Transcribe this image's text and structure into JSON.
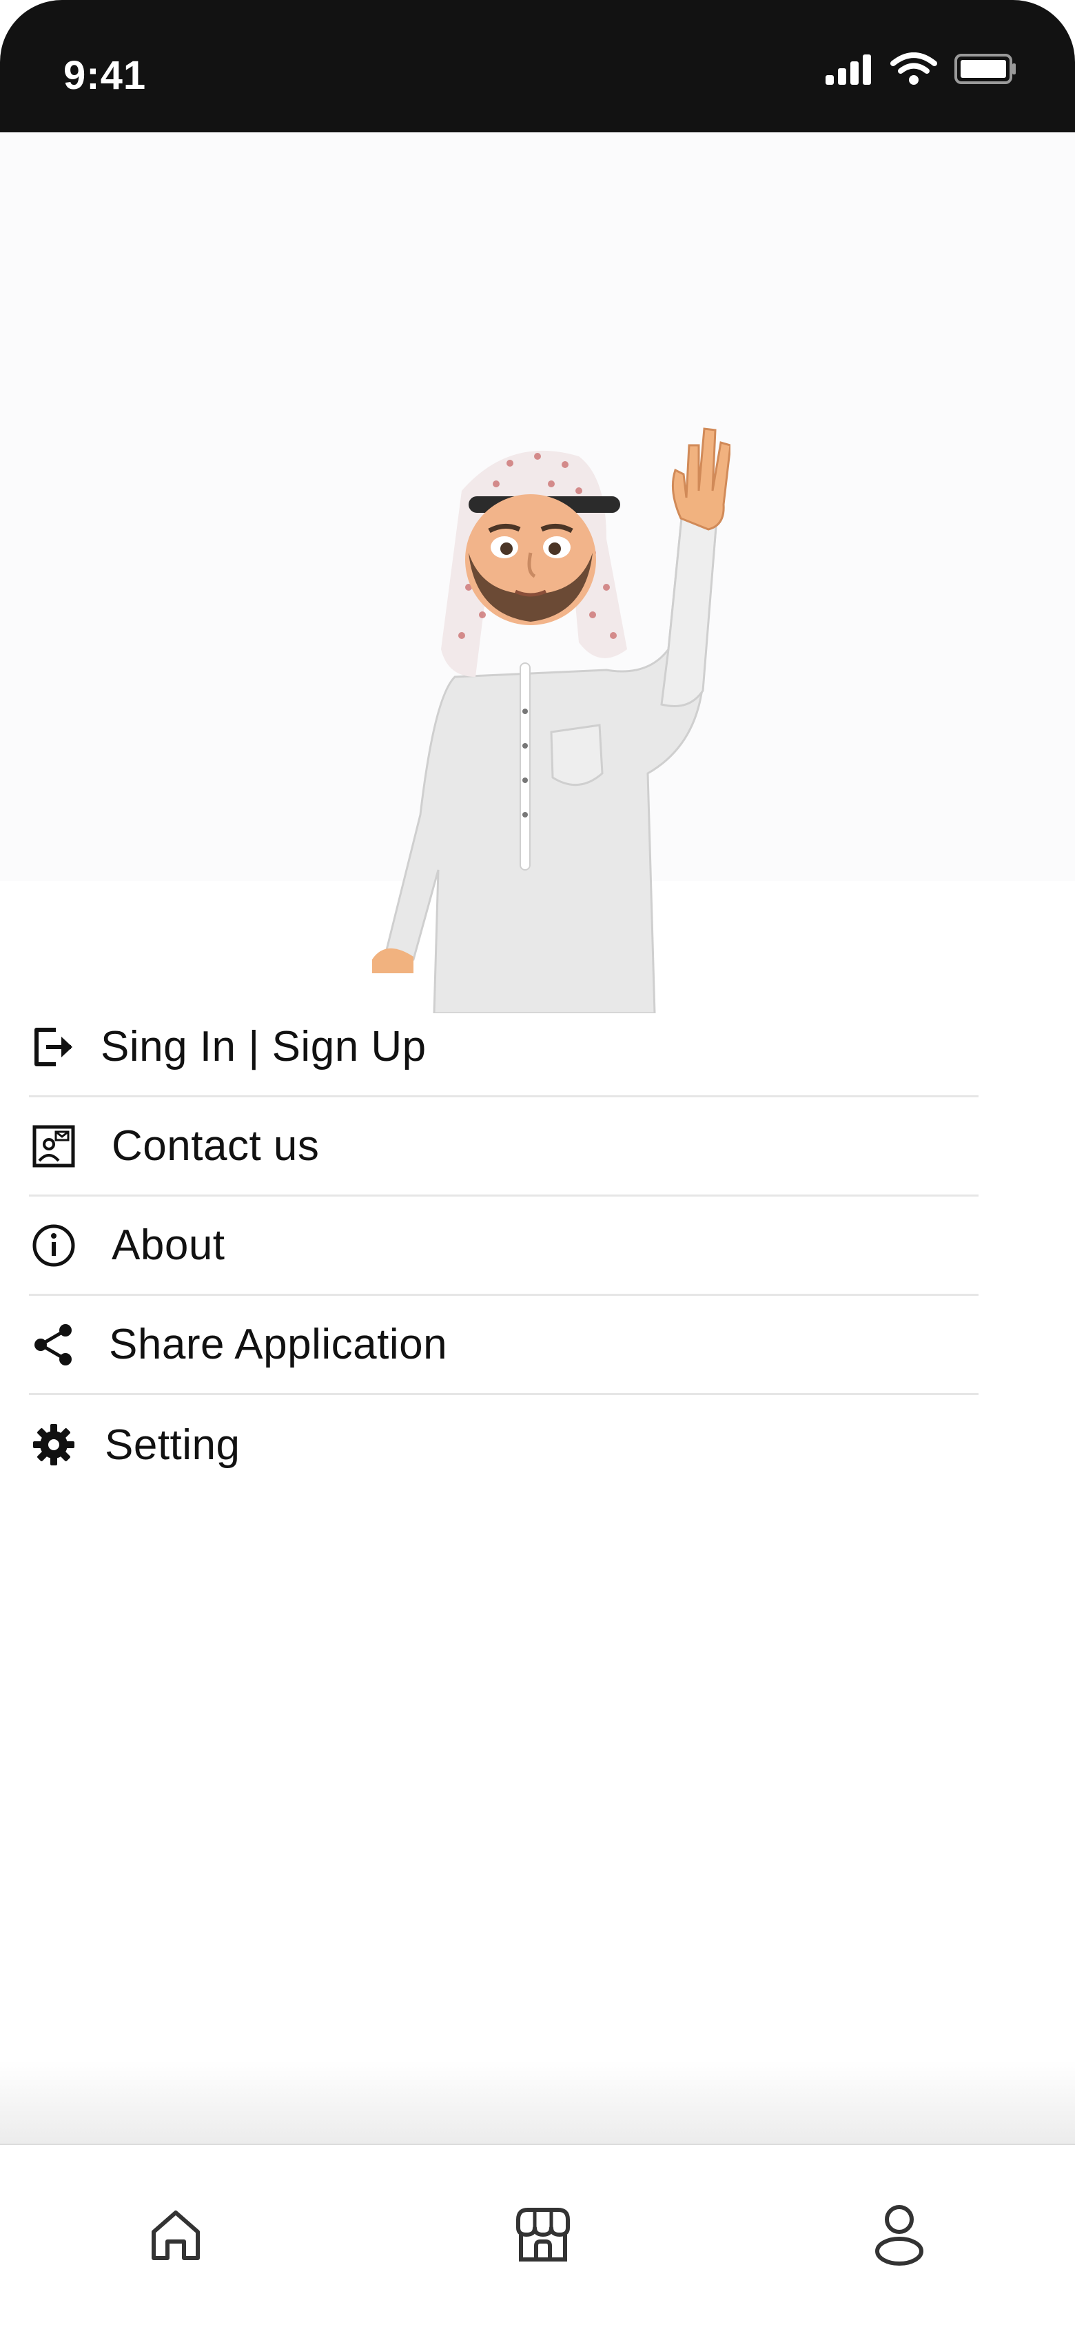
{
  "status_bar": {
    "time": "9:41"
  },
  "menu": {
    "items": [
      {
        "label": "Sing In | Sign Up",
        "icon": "sign-in-icon"
      },
      {
        "label": "Contact us",
        "icon": "contact-card-icon"
      },
      {
        "label": "About",
        "icon": "info-icon"
      },
      {
        "label": "Share Application",
        "icon": "share-icon"
      },
      {
        "label": "Setting",
        "icon": "gear-icon"
      }
    ]
  },
  "tabbar": {
    "tabs": [
      {
        "icon": "home-icon"
      },
      {
        "icon": "store-icon"
      },
      {
        "icon": "profile-icon"
      }
    ]
  },
  "colors": {
    "status_bar_bg": "#121212",
    "text": "#111111",
    "divider": "#e6e6e6"
  }
}
